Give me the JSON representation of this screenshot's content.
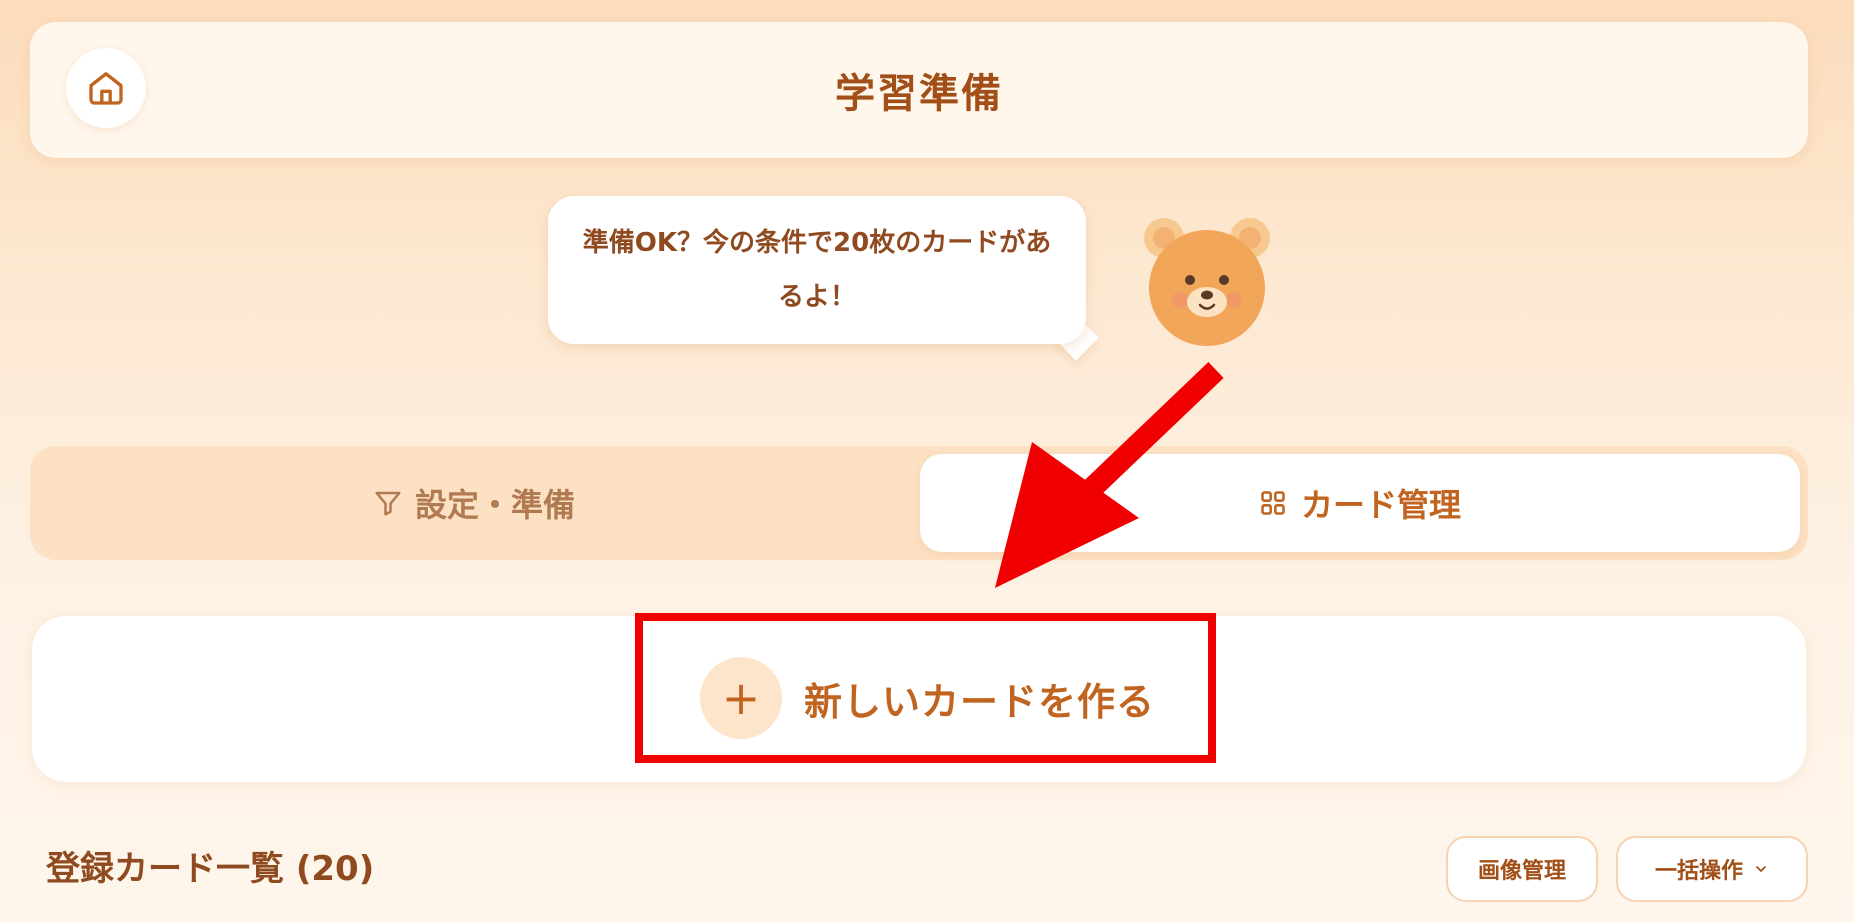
{
  "header": {
    "title": "学習準備",
    "home_icon": "home-icon"
  },
  "mascot": {
    "message": "準備OK？今の条件で20枚のカードがあるよ！",
    "icon": "bear-icon"
  },
  "tabs": [
    {
      "label": "設定・準備",
      "icon": "filter-icon",
      "active": false
    },
    {
      "label": "カード管理",
      "icon": "grid-icon",
      "active": true
    }
  ],
  "create_card": {
    "label": "新しいカードを作る",
    "icon": "plus-icon",
    "plus_glyph": "+"
  },
  "card_list": {
    "title": "登録カード一覧 (20)",
    "image_manage_label": "画像管理",
    "bulk_action_label": "一括操作",
    "bulk_icon": "chevron-down-icon"
  },
  "colors": {
    "accent": "#c0641f",
    "annotation": "#f00000"
  }
}
